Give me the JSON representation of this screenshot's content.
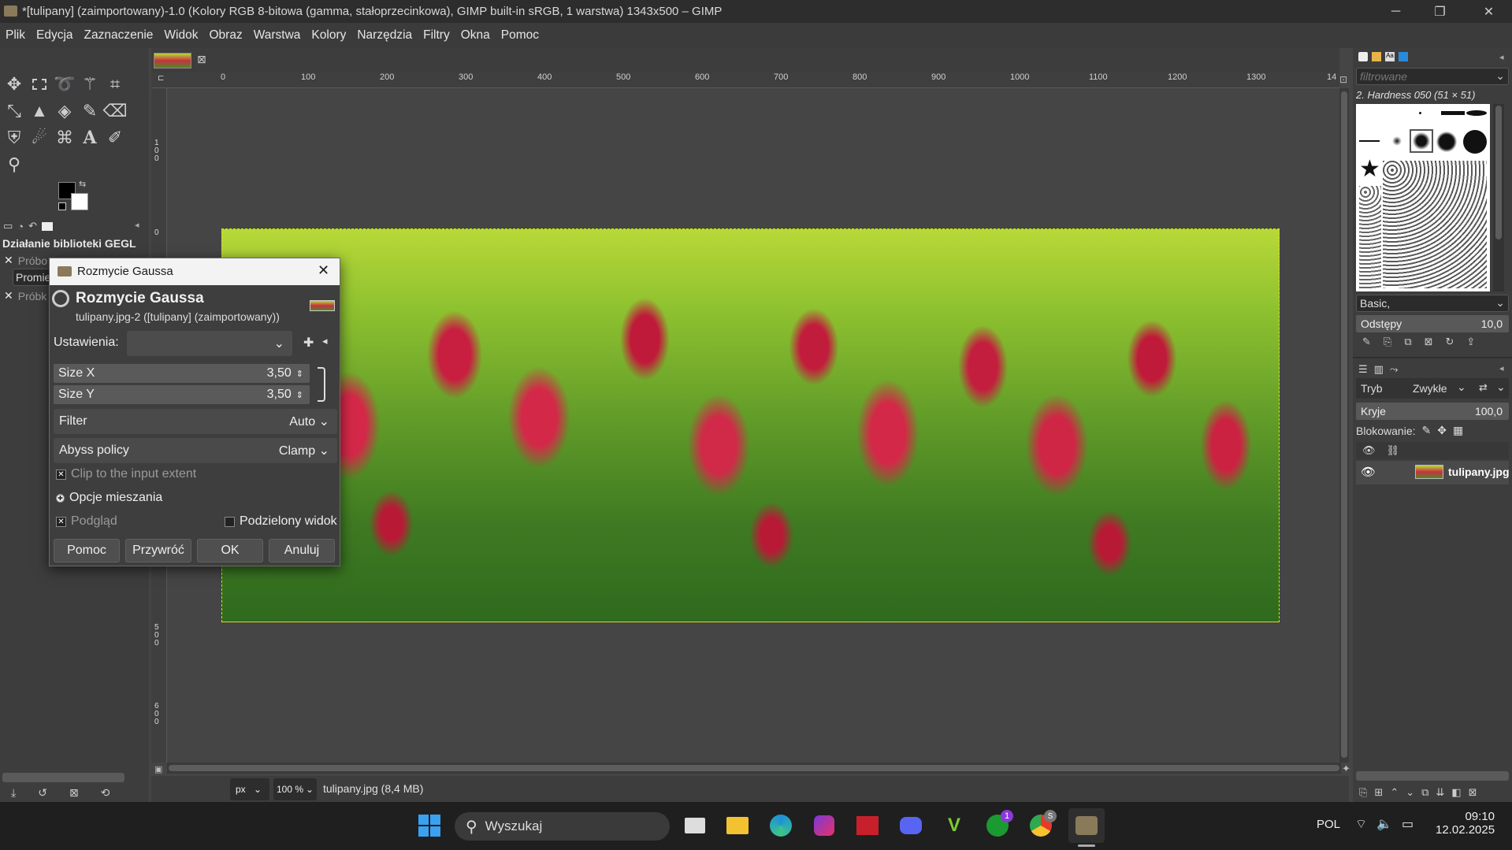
{
  "window": {
    "title": "*[tulipany] (zaimportowany)-1.0 (Kolory RGB 8-bitowa (gamma, stałoprzecinkowa), GIMP built-in sRGB, 1 warstwa) 1343x500 – GIMP"
  },
  "menu": [
    "Plik",
    "Edycja",
    "Zaznaczenie",
    "Widok",
    "Obraz",
    "Warstwa",
    "Kolory",
    "Narzędzia",
    "Filtry",
    "Okna",
    "Pomoc"
  ],
  "left_panel": {
    "title": "Działanie biblioteki GEGL",
    "row1": "Próbo",
    "row2": "Promie",
    "row3": "Próbk"
  },
  "ruler": {
    "top": [
      "0",
      "100",
      "200",
      "300",
      "400",
      "500",
      "600",
      "700",
      "800",
      "900",
      "1000",
      "1100",
      "1200",
      "1300",
      "14"
    ],
    "left": [
      "0",
      "1 0 0",
      "0",
      "5 0 0",
      "6 0 0"
    ]
  },
  "dialog": {
    "window_title": "Rozmycie Gaussa",
    "heading": "Rozmycie Gaussa",
    "subtitle": "tulipany.jpg-2 ([tulipany] (zaimportowany))",
    "settings_label": "Ustawienia:",
    "size_x_label": "Size X",
    "size_x_value": "3,50",
    "size_y_label": "Size Y",
    "size_y_value": "3,50",
    "filter_label": "Filter",
    "filter_value": "Auto",
    "abyss_label": "Abyss policy",
    "abyss_value": "Clamp",
    "clip_label": "Clip to the input extent",
    "blend_label": "Opcje mieszania",
    "preview_label": "Podgląd",
    "split_label": "Podzielony widok",
    "btn_help": "Pomoc",
    "btn_reset": "Przywróć",
    "btn_ok": "OK",
    "btn_cancel": "Anuluj"
  },
  "status": {
    "unit": "px",
    "zoom": "100 %",
    "file_info": "tulipany.jpg (8,4 MB)"
  },
  "right_dock": {
    "filter_placeholder": "filtrowane",
    "brush_name": "2. Hardness 050 (51 × 51)",
    "brush_tag": "Basic,",
    "spacing_label": "Odstępy",
    "spacing_value": "10,0",
    "mode_label": "Tryb",
    "mode_value": "Zwykłe",
    "opacity_label": "Kryje",
    "opacity_value": "100,0",
    "lock_label": "Blokowanie:",
    "layer_name": "tulipany.jpg"
  },
  "taskbar": {
    "search_placeholder": "Wyszukaj",
    "lang": "POL",
    "time": "09:10",
    "date": "12.02.2025",
    "xbox_badge": "1",
    "chrome_badge": "S"
  }
}
